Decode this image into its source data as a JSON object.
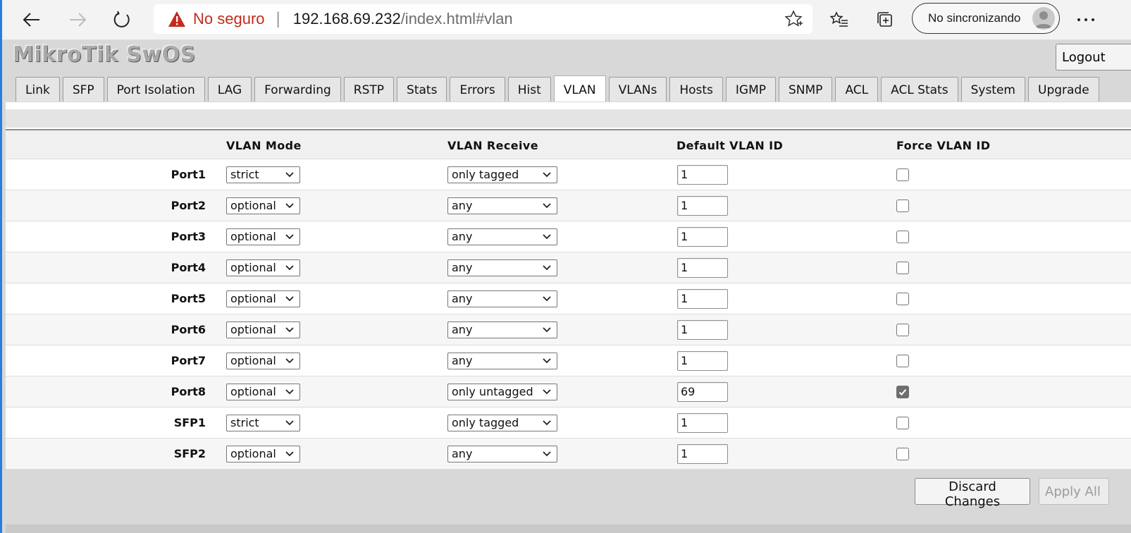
{
  "browser": {
    "not_secure": "No seguro",
    "separator": "|",
    "url_host": "192.168.69.232",
    "url_path": "/index.html#vlan",
    "profile_label": "No sincronizando",
    "warning_color": "#c42b1c"
  },
  "app": {
    "title": "MikroTik SwOS",
    "logout_label": "Logout"
  },
  "tabs": [
    {
      "label": "Link"
    },
    {
      "label": "SFP"
    },
    {
      "label": "Port Isolation"
    },
    {
      "label": "LAG"
    },
    {
      "label": "Forwarding"
    },
    {
      "label": "RSTP"
    },
    {
      "label": "Stats"
    },
    {
      "label": "Errors"
    },
    {
      "label": "Hist"
    },
    {
      "label": "VLAN",
      "active": true
    },
    {
      "label": "VLANs"
    },
    {
      "label": "Hosts"
    },
    {
      "label": "IGMP"
    },
    {
      "label": "SNMP"
    },
    {
      "label": "ACL"
    },
    {
      "label": "ACL Stats"
    },
    {
      "label": "System"
    },
    {
      "label": "Upgrade"
    }
  ],
  "table": {
    "headers": {
      "vlan_mode": "VLAN Mode",
      "vlan_receive": "VLAN Receive",
      "default_vlan_id": "Default VLAN ID",
      "force_vlan_id": "Force VLAN ID"
    },
    "rows": [
      {
        "port": "Port1",
        "mode": "strict",
        "receive": "only tagged",
        "default_id": "1",
        "force": false
      },
      {
        "port": "Port2",
        "mode": "optional",
        "receive": "any",
        "default_id": "1",
        "force": false
      },
      {
        "port": "Port3",
        "mode": "optional",
        "receive": "any",
        "default_id": "1",
        "force": false
      },
      {
        "port": "Port4",
        "mode": "optional",
        "receive": "any",
        "default_id": "1",
        "force": false
      },
      {
        "port": "Port5",
        "mode": "optional",
        "receive": "any",
        "default_id": "1",
        "force": false
      },
      {
        "port": "Port6",
        "mode": "optional",
        "receive": "any",
        "default_id": "1",
        "force": false
      },
      {
        "port": "Port7",
        "mode": "optional",
        "receive": "any",
        "default_id": "1",
        "force": false
      },
      {
        "port": "Port8",
        "mode": "optional",
        "receive": "only untagged",
        "default_id": "69",
        "force": true
      },
      {
        "port": "SFP1",
        "mode": "strict",
        "receive": "only tagged",
        "default_id": "1",
        "force": false
      },
      {
        "port": "SFP2",
        "mode": "optional",
        "receive": "any",
        "default_id": "1",
        "force": false
      }
    ]
  },
  "footer": {
    "discard_label": "Discard Changes",
    "apply_label": "Apply All"
  }
}
